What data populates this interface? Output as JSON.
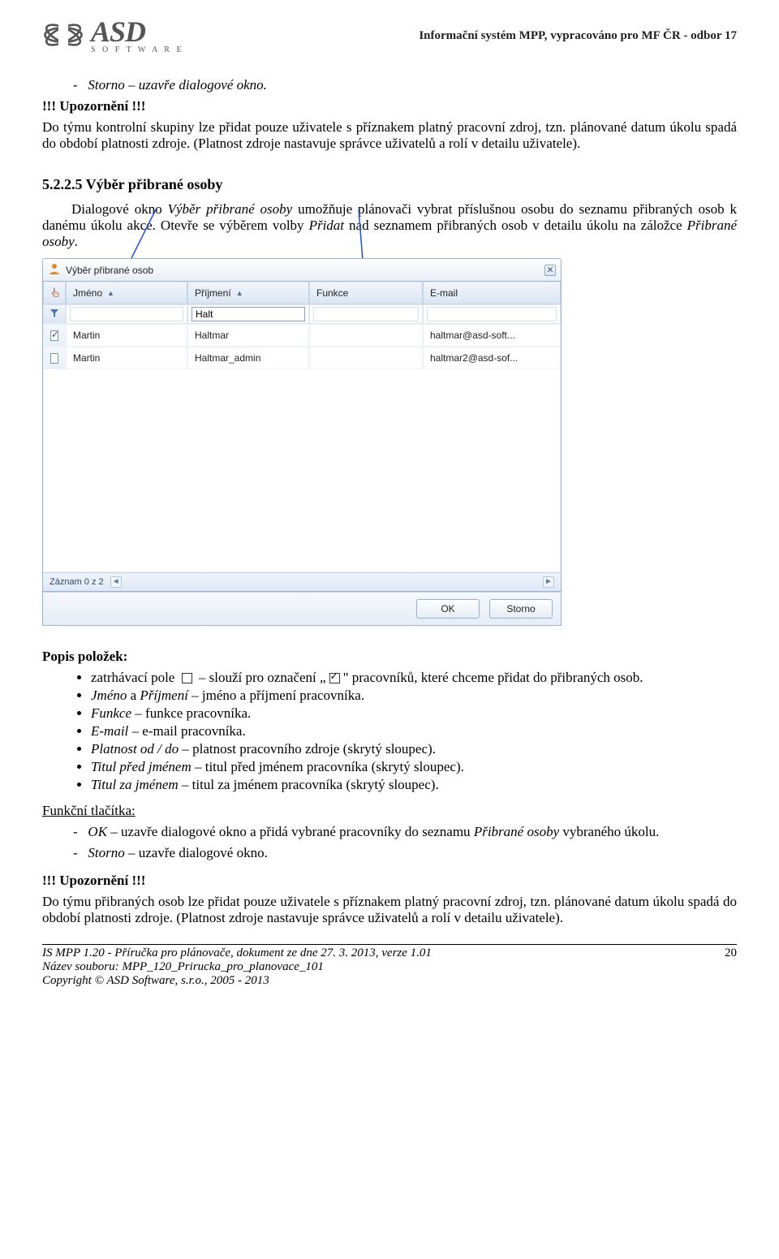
{
  "header": {
    "logo_title": "ASD",
    "logo_sub": "S O F T W A R E",
    "right": "Informační systém MPP, vypracováno pro MF ČR - odbor 17"
  },
  "intro": {
    "storno_line": "Storno – uzavře dialogové okno.",
    "warning_label": "!!! Upozornění !!!",
    "warning_text": "Do týmu kontrolní skupiny lze přidat pouze uživatele s příznakem platný pracovní zdroj, tzn. plánované datum úkolu spadá do období platnosti zdroje. (Platnost zdroje nastavuje správce uživatelů a rolí v detailu uživatele)."
  },
  "section": {
    "heading": "5.2.2.5 Výběr přibrané osoby",
    "p1_a": "Dialogové okno ",
    "p1_i1": "Výběr přibrané osoby",
    "p1_b": " umožňuje plánovači vybrat příslušnou osobu do seznamu přibraných osob k danému úkolu akce. Otevře se výběrem volby ",
    "p1_i2": "Přidat",
    "p1_c": " nad seznamem přibraných osob v detailu úkolu na záložce ",
    "p1_i3": "Přibrané osoby",
    "p1_d": "."
  },
  "dialog": {
    "title": "Výběr přibrané osob",
    "cols": {
      "jmeno": "Jméno",
      "prijmeni": "Příjmení",
      "funkce": "Funkce",
      "email": "E-mail"
    },
    "filter_value": "Halt",
    "rows": [
      {
        "checked": true,
        "jmeno": "Martin",
        "prijmeni": "Haltmar",
        "funkce": "",
        "email": "haltmar@asd-soft..."
      },
      {
        "checked": false,
        "jmeno": "Martin",
        "prijmeni": "Haltmar_admin",
        "funkce": "",
        "email": "haltmar2@asd-sof..."
      }
    ],
    "footer_status": "Záznam 0 z 2",
    "ok_label": "OK",
    "storno_label": "Storno"
  },
  "popis": {
    "heading": "Popis položek:",
    "b1_a": "zatrhávací pole ",
    "b1_b": " – slouží pro označení „",
    "b1_c": "\" pracovníků, které chceme přidat do přibraných osob.",
    "b2_i": "Jméno",
    "b2_a": " a ",
    "b2_i2": "Příjmení",
    "b2_b": " – jméno a příjmení pracovníka.",
    "b3_i": "Funkce",
    "b3_b": " – funkce pracovníka.",
    "b4_i": "E-mail",
    "b4_b": " – e-mail pracovníka.",
    "b5_i": "Platnost od / do",
    "b5_b": " – platnost pracovního zdroje (skrytý sloupec).",
    "b6_i": "Titul před jménem",
    "b6_b": " – titul před jménem pracovníka (skrytý sloupec).",
    "b7_i": "Titul za jménem",
    "b7_b": " – titul za jménem pracovníka (skrytý sloupec)."
  },
  "funk": {
    "heading": "Funkční tlačítka:",
    "l1_i": "OK",
    "l1_a": " – uzavře dialogové okno a přidá vybrané pracovníky do seznamu ",
    "l1_i2": "Přibrané osoby",
    "l1_b": " vybraného úkolu.",
    "l2_i": "Storno",
    "l2_b": " – uzavře dialogové okno."
  },
  "warn2": {
    "label": "!!! Upozornění !!!",
    "text": "Do týmu přibraných osob lze přidat pouze uživatele s příznakem platný pracovní zdroj, tzn. plánované datum úkolu spadá do období platnosti zdroje. (Platnost zdroje nastavuje správce uživatelů a rolí v detailu uživatele)."
  },
  "footer": {
    "l1": "IS MPP 1.20 - Příručka pro plánovače, dokument ze dne 27. 3. 2013, verze 1.01",
    "l2": "Název souboru: MPP_120_Prirucka_pro_planovace_101",
    "l3": "Copyright © ASD Software, s.r.o., 2005 - 2013",
    "page": "20"
  }
}
